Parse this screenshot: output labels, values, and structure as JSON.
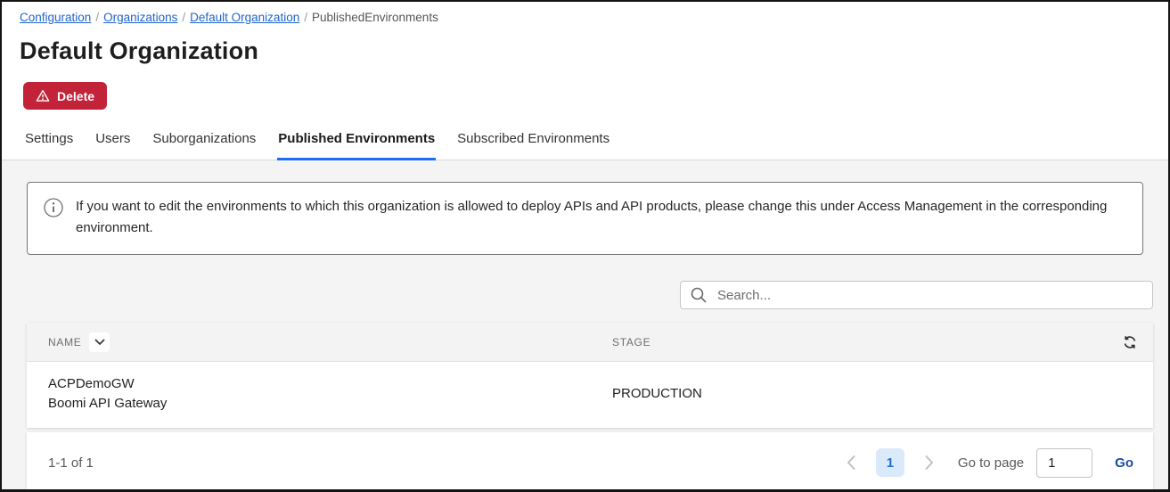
{
  "breadcrumb": {
    "separator": "/",
    "links": [
      "Configuration",
      "Organizations",
      "Default Organization"
    ],
    "current": "PublishedEnvironments"
  },
  "page": {
    "title": "Default Organization"
  },
  "actions": {
    "delete_label": "Delete"
  },
  "tabs": {
    "items": [
      {
        "label": "Settings",
        "active": false
      },
      {
        "label": "Users",
        "active": false
      },
      {
        "label": "Suborganizations",
        "active": false
      },
      {
        "label": "Published Environments",
        "active": true
      },
      {
        "label": "Subscribed Environments",
        "active": false
      }
    ]
  },
  "notice": {
    "text": "If you want to edit the environments to which this organization is allowed to deploy APIs and API products, please change this under Access Management in the corresponding environment."
  },
  "search": {
    "placeholder": "Search...",
    "value": ""
  },
  "table": {
    "columns": [
      "NAME",
      "STAGE"
    ],
    "rows": [
      {
        "name_line1": "ACPDemoGW",
        "name_line2": "Boomi API Gateway",
        "stage": "PRODUCTION"
      }
    ]
  },
  "pagination": {
    "range_label": "1-1 of 1",
    "current_page": "1",
    "go_to_page_label": "Go to page",
    "page_input_value": "1",
    "go_label": "Go"
  },
  "icons": {
    "delete_button": "warning-triangle-icon",
    "notice": "info-circle-icon",
    "search": "magnifier-icon",
    "name_column": "chevron-down-sort-icon",
    "table_right": "refresh-icon",
    "pager": [
      "chevron-left-icon",
      "chevron-right-icon"
    ]
  },
  "colors": {
    "danger_red": "#c22339",
    "accent_blue": "#1b6ef3",
    "link_blue": "#2064ce",
    "page_chip_bg": "#dbeafb",
    "page_chip_text": "#1d6fd6",
    "go_link": "#1b4c9e",
    "content_bg": "#f4f4f5",
    "table_header_bg": "#f3f3f3"
  }
}
